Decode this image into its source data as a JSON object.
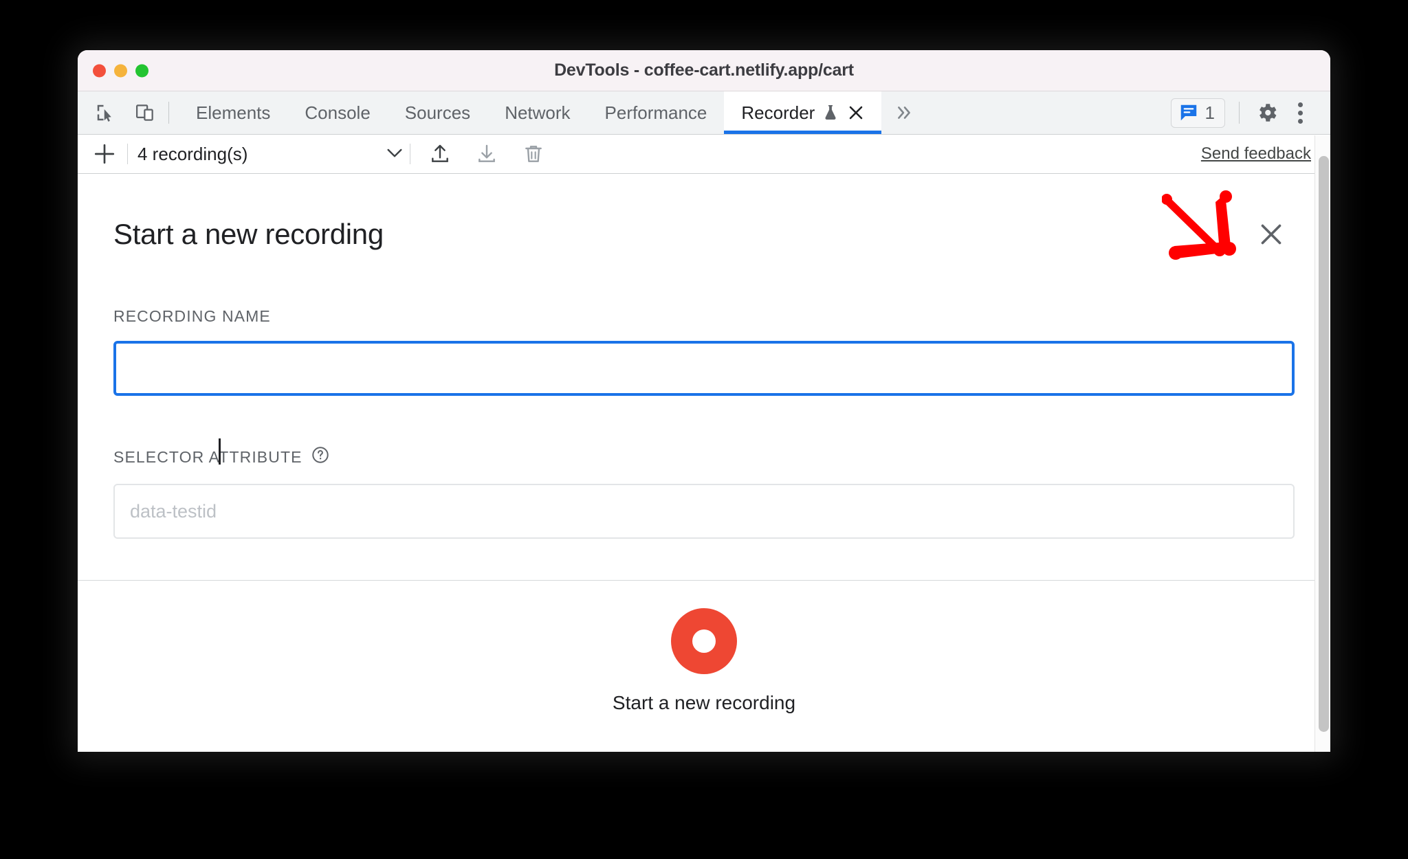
{
  "window": {
    "title": "DevTools - coffee-cart.netlify.app/cart",
    "traffic_lights": [
      "close",
      "minimize",
      "maximize"
    ],
    "colors": {
      "accent_blue": "#1a73e8",
      "record_red": "#ee4733",
      "annotation_red": "#ff0000",
      "titlebar_bg": "#f7f2f5",
      "tabbar_bg": "#f1f3f4"
    }
  },
  "tabbar": {
    "left_icons": [
      {
        "name": "inspect-element-icon",
        "label": "Inspect element"
      },
      {
        "name": "device-toolbar-icon",
        "label": "Toggle device toolbar"
      }
    ],
    "tabs": [
      {
        "label": "Elements",
        "active": false
      },
      {
        "label": "Console",
        "active": false
      },
      {
        "label": "Sources",
        "active": false
      },
      {
        "label": "Network",
        "active": false
      },
      {
        "label": "Performance",
        "active": false
      },
      {
        "label": "Recorder",
        "active": true,
        "experimental": true,
        "closable": true
      }
    ],
    "more_tabs_label": "»",
    "issues": {
      "count": "1",
      "icon": "issues-message-icon"
    },
    "settings_label": "Settings",
    "menu_label": "Customize and control DevTools"
  },
  "recorder_toolbar": {
    "add_label": "+",
    "selected_recording": "4 recording(s)",
    "dropdown_icon": "chevron-down-icon",
    "actions": [
      {
        "name": "export-icon",
        "label": "Export"
      },
      {
        "name": "import-icon",
        "label": "Import"
      },
      {
        "name": "delete-icon",
        "label": "Delete recording"
      }
    ],
    "feedback_link": "Send feedback"
  },
  "panel": {
    "title": "Start a new recording",
    "close_label": "×",
    "fields": [
      {
        "label": "RECORDING NAME",
        "value": "",
        "placeholder": "",
        "focused": true,
        "help": false
      },
      {
        "label": "SELECTOR ATTRIBUTE",
        "value": "",
        "placeholder": "data-testid",
        "focused": false,
        "help": true,
        "help_icon": "help-circle-icon"
      }
    ],
    "cta": {
      "icon": "record-circle-icon",
      "label": "Start a new recording"
    }
  },
  "annotation": {
    "arrow": "red-arrow-pointing-down-right",
    "target": "panel-close-button"
  },
  "scrollbar": {
    "orientation": "vertical",
    "position": "right"
  }
}
